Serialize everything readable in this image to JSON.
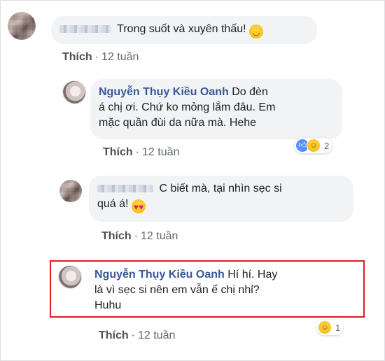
{
  "comments": [
    {
      "author": "",
      "author_blurred": true,
      "text": "Trong suốt và xuyên thấu!",
      "emoji": "grinning-face-with-smiling-eyes",
      "like_label": "Thích",
      "time": "12 tuần"
    },
    {
      "author": "Nguyễn Thụy Kiều Oanh",
      "line1": "Do đèn",
      "line2": "á chị ơi. Chứ ko mỏng lắm đâu. Em",
      "line3": "mặc quần đùi da nữa mà. Hehe",
      "like_label": "Thích",
      "time": "12 tuần",
      "reactions": [
        "like",
        "haha"
      ],
      "reaction_count": "2"
    },
    {
      "author": "",
      "author_blurred": true,
      "line1": "C biết mà, tại nhìn sẹc si",
      "line2": "quá á!",
      "emoji": "heart-eyes-face",
      "like_label": "Thích",
      "time": "12 tuần"
    },
    {
      "author": "Nguyễn Thụy Kiều Oanh",
      "line1": "Hí hí. Hay",
      "line2": "là vì sẹc si nên em vẫn ế chị nhỉ?",
      "line3": "Huhu",
      "like_label": "Thích",
      "time": "12 tuần",
      "reactions": [
        "haha"
      ],
      "reaction_count": "1",
      "highlighted": true
    }
  ],
  "separator": "·",
  "colors": {
    "name": "#385898",
    "bubble": "#f2f3f5",
    "meta": "#606770",
    "highlight_border": "#e0191f",
    "like_reaction": "#5890ff"
  }
}
